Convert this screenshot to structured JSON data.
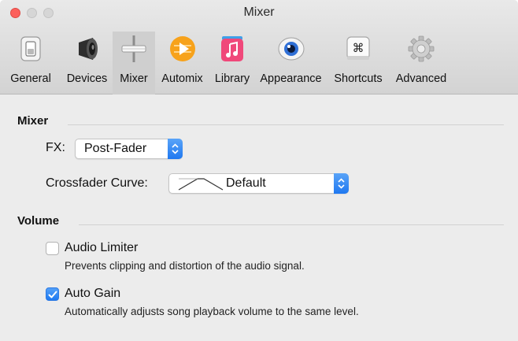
{
  "window": {
    "title": "Mixer"
  },
  "toolbar": {
    "tabs": [
      {
        "label": "General",
        "icon": "switch-icon"
      },
      {
        "label": "Devices",
        "icon": "speaker-icon"
      },
      {
        "label": "Mixer",
        "icon": "fader-icon",
        "selected": true
      },
      {
        "label": "Automix",
        "icon": "play-icon"
      },
      {
        "label": "Library",
        "icon": "music-note-icon"
      },
      {
        "label": "Appearance",
        "icon": "eye-icon"
      },
      {
        "label": "Shortcuts",
        "icon": "command-key-icon"
      },
      {
        "label": "Advanced",
        "icon": "gear-icon"
      }
    ],
    "shortcut_glyph": "⌘"
  },
  "mixer": {
    "section_title": "Mixer",
    "fx_label": "FX:",
    "fx_value": "Post-Fader",
    "crossfader_label": "Crossfader Curve:",
    "crossfader_value": "Default"
  },
  "volume": {
    "section_title": "Volume",
    "audio_limiter": {
      "label": "Audio Limiter",
      "description": "Prevents clipping and distortion of the audio signal.",
      "checked": false
    },
    "auto_gain": {
      "label": "Auto Gain",
      "description": "Automatically adjusts song playback volume to the same level.",
      "checked": true
    }
  },
  "colors": {
    "accent": "#1f78f0",
    "close_button": "#fc605c",
    "automix_orange": "#f7a21b",
    "library_pink": "#f0487a"
  }
}
